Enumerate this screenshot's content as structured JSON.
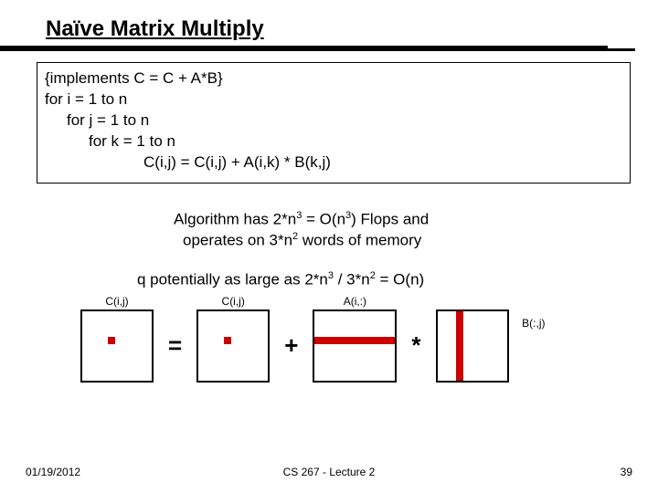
{
  "title": "Naïve Matrix Multiply",
  "code": {
    "line1": "{implements C = C + A*B}",
    "line2": "for i = 1 to n",
    "line3": "for j = 1 to n",
    "line4": "for k = 1 to n",
    "line5": "C(i,j) = C(i,j) + A(i,k) * B(k,j)"
  },
  "analysis": {
    "flops_a": "Algorithm has 2*n",
    "flops_b": " = O(n",
    "flops_c": ") Flops and",
    "memory_a": "operates on 3*n",
    "memory_b": " words of memory",
    "q_a": "q potentially as large as 2*n",
    "q_b": " / 3*n",
    "q_c": " = O(n)"
  },
  "exponents": {
    "three": "3",
    "two": "2"
  },
  "matrices": {
    "c_left": "C(i,j)",
    "c_right": "C(i,j)",
    "a": "A(i,:)",
    "b": "B(:,j)"
  },
  "ops": {
    "eq": "=",
    "plus": "+",
    "star": "*"
  },
  "footer": {
    "date": "01/19/2012",
    "center": "CS 267 - Lecture 2",
    "page": "39"
  }
}
